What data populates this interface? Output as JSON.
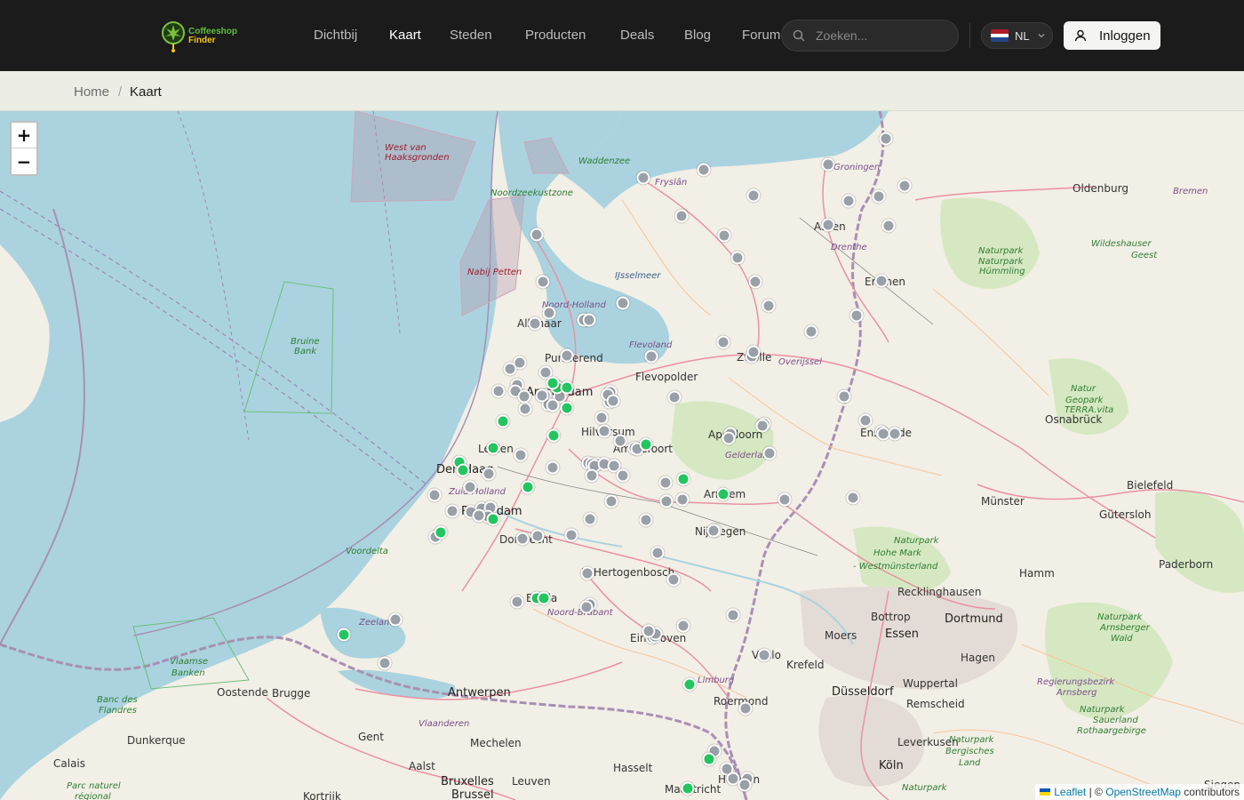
{
  "header": {
    "logo_line1": "Coffeeshop",
    "logo_line2": "Finder",
    "nav": [
      {
        "label": "Dichtbij",
        "active": false
      },
      {
        "label": "Kaart",
        "active": true
      },
      {
        "label": "Steden",
        "active": false
      },
      {
        "label": "Producten",
        "active": false
      },
      {
        "label": "Deals",
        "active": false
      },
      {
        "label": "Blog",
        "active": false
      },
      {
        "label": "Forum",
        "active": false
      }
    ],
    "search_placeholder": "Zoeken...",
    "language": "NL",
    "login_label": "Inloggen"
  },
  "breadcrumb": {
    "home": "Home",
    "separator": "/",
    "current": "Kaart"
  },
  "map": {
    "zoom_in": "+",
    "zoom_out": "−",
    "attribution": {
      "leaflet": "Leaflet",
      "separator": "| ©",
      "osm": "OpenStreetMap",
      "suffix": "contributors"
    },
    "labels": [
      {
        "text": "West van",
        "style": "red"
      },
      {
        "text": "Haaksgronden",
        "style": "red"
      },
      {
        "text": "Waddenzee",
        "style": "green"
      },
      {
        "text": "Noordzeekustzone",
        "style": "green"
      },
      {
        "text": "Fryslân",
        "style": "purple"
      },
      {
        "text": "Groningen",
        "style": "purple"
      },
      {
        "text": "Oldenburg",
        "style": "city"
      },
      {
        "text": "Bremen",
        "style": "purple"
      },
      {
        "text": "Assen",
        "style": "city"
      },
      {
        "text": "Drenthe",
        "style": "purple"
      },
      {
        "text": "Emmen",
        "style": "city"
      },
      {
        "text": "Naturpark",
        "style": "green"
      },
      {
        "text": "Wildeshauser",
        "style": "green"
      },
      {
        "text": "Geest",
        "style": "green"
      },
      {
        "text": "Naturpark",
        "style": "green"
      },
      {
        "text": "Hümmling",
        "style": "green"
      },
      {
        "text": "Nabij Petten",
        "style": "red"
      },
      {
        "text": "IJsselmeer",
        "style": "blue"
      },
      {
        "text": "Noord-Holland",
        "style": "purple"
      },
      {
        "text": "Alkmaar",
        "style": "city"
      },
      {
        "text": "Purmerend",
        "style": "city"
      },
      {
        "text": "Flevoland",
        "style": "purple"
      },
      {
        "text": "Flevopolder",
        "style": "city"
      },
      {
        "text": "Zwolle",
        "style": "city"
      },
      {
        "text": "Overijssel",
        "style": "purple"
      },
      {
        "text": "Bruine",
        "style": "green"
      },
      {
        "text": "Bank",
        "style": "green"
      },
      {
        "text": "Amsterdam",
        "style": "big"
      },
      {
        "text": "Natur",
        "style": "green"
      },
      {
        "text": "Geopark",
        "style": "green"
      },
      {
        "text": "TERRA.vita",
        "style": "green"
      },
      {
        "text": "Osnabrück",
        "style": "city"
      },
      {
        "text": "Enschede",
        "style": "city"
      },
      {
        "text": "Hilversum",
        "style": "city"
      },
      {
        "text": "Apeldoorn",
        "style": "city"
      },
      {
        "text": "Leiden",
        "style": "city"
      },
      {
        "text": "Amersfoort",
        "style": "city"
      },
      {
        "text": "Gelderland",
        "style": "purple"
      },
      {
        "text": "Den Haag",
        "style": "big"
      },
      {
        "text": "Zuid-Holland",
        "style": "purple"
      },
      {
        "text": "Arnhem",
        "style": "city"
      },
      {
        "text": "Rotterdam",
        "style": "big"
      },
      {
        "text": "Münster",
        "style": "city"
      },
      {
        "text": "Bielefeld",
        "style": "city"
      },
      {
        "text": "Gütersloh",
        "style": "city"
      },
      {
        "text": "Dordrecht",
        "style": "city"
      },
      {
        "text": "Nijmegen",
        "style": "city"
      },
      {
        "text": "Voordelta",
        "style": "green"
      },
      {
        "text": "Naturpark",
        "style": "green"
      },
      {
        "text": "Hohe Mark",
        "style": "green"
      },
      {
        "text": "- Westmünsterland",
        "style": "green"
      },
      {
        "text": "'s-Hertogenbosch",
        "style": "city"
      },
      {
        "text": "Paderborn",
        "style": "city"
      },
      {
        "text": "Hamm",
        "style": "city"
      },
      {
        "text": "Recklinghausen",
        "style": "city"
      },
      {
        "text": "Breda",
        "style": "city"
      },
      {
        "text": "Noord-Brabant",
        "style": "purple"
      },
      {
        "text": "Zeeland",
        "style": "purple"
      },
      {
        "text": "Bottrop",
        "style": "city"
      },
      {
        "text": "Dortmund",
        "style": "big"
      },
      {
        "text": "Eindhoven",
        "style": "city"
      },
      {
        "text": "Essen",
        "style": "big"
      },
      {
        "text": "Moers",
        "style": "city"
      },
      {
        "text": "Venlo",
        "style": "city"
      },
      {
        "text": "Naturpark",
        "style": "green"
      },
      {
        "text": "Arnsberger",
        "style": "green"
      },
      {
        "text": "Wald",
        "style": "green"
      },
      {
        "text": "Hagen",
        "style": "city"
      },
      {
        "text": "Vlaamse",
        "style": "green"
      },
      {
        "text": "Banken",
        "style": "green"
      },
      {
        "text": "Krefeld",
        "style": "city"
      },
      {
        "text": "Oostende",
        "style": "city"
      },
      {
        "text": "Brugge",
        "style": "city"
      },
      {
        "text": "Antwerpen",
        "style": "big"
      },
      {
        "text": "Limburg",
        "style": "purple"
      },
      {
        "text": "Wuppertal",
        "style": "city"
      },
      {
        "text": "Düsseldorf",
        "style": "big"
      },
      {
        "text": "Regierungsbezirk",
        "style": "purple"
      },
      {
        "text": "Arnsberg",
        "style": "purple"
      },
      {
        "text": "Banc des",
        "style": "green"
      },
      {
        "text": "Flandres",
        "style": "green"
      },
      {
        "text": "Roermond",
        "style": "city"
      },
      {
        "text": "Remscheid",
        "style": "city"
      },
      {
        "text": "Vlaanderen",
        "style": "purple"
      },
      {
        "text": "Naturpark",
        "style": "green"
      },
      {
        "text": "Sauerland",
        "style": "green"
      },
      {
        "text": "Rothaargebirge",
        "style": "green"
      },
      {
        "text": "Gent",
        "style": "city"
      },
      {
        "text": "Mechelen",
        "style": "city"
      },
      {
        "text": "Leverkusen",
        "style": "city"
      },
      {
        "text": "Dunkerque",
        "style": "city"
      },
      {
        "text": "Naturpark",
        "style": "green"
      },
      {
        "text": "Bergisches",
        "style": "green"
      },
      {
        "text": "Land",
        "style": "green"
      },
      {
        "text": "Calais",
        "style": "city"
      },
      {
        "text": "Aalst",
        "style": "city"
      },
      {
        "text": "Hasselt",
        "style": "city"
      },
      {
        "text": "Köln",
        "style": "big"
      },
      {
        "text": "Bruxelles",
        "style": "big"
      },
      {
        "text": "Leuven",
        "style": "city"
      },
      {
        "text": "Heerlen",
        "style": "city"
      },
      {
        "text": "Siegen",
        "style": "city"
      },
      {
        "text": "Parc naturel",
        "style": "green"
      },
      {
        "text": "régional",
        "style": "green"
      },
      {
        "text": "Brussel",
        "style": "big"
      },
      {
        "text": "Kortrijk",
        "style": "city"
      },
      {
        "text": "Maastricht",
        "style": "city"
      },
      {
        "text": "Naturpark",
        "style": "green"
      }
    ],
    "markers_green": 20,
    "markers_grey": 150
  }
}
